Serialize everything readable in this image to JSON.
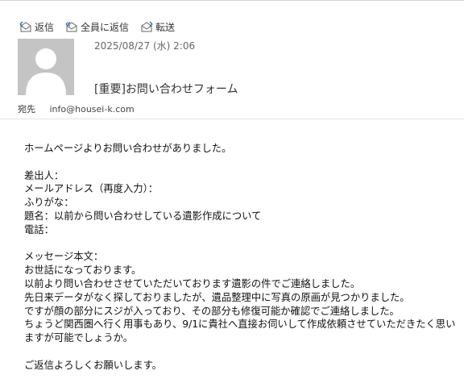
{
  "toolbar": {
    "reply": "返信",
    "reply_all": "全員に返信",
    "forward": "転送"
  },
  "header": {
    "date": "2025/08/27 (水) 2:06",
    "subject": "[重要]お問い合わせフォーム",
    "to_label": "宛先",
    "to_address": "info@housei-k.com"
  },
  "body": {
    "intro": "ホームページよりお問い合わせがありました。",
    "fields": [
      "差出人：",
      "メールアドレス（再度入力）：",
      "ふりがな：",
      "題名：以前から問い合わせしている遺影作成について",
      "電話："
    ],
    "message_label": "メッセージ本文：",
    "message_lines": [
      "お世話になっております。",
      "以前より問い合わせさせていただいております遺影の件でご連絡しました。",
      "先日来データがなく探しておりましたが、遺品整理中に写真の原画が見つかりました。",
      "ですが顔の部分にスジが入っており、その部分も修復可能か確認でご連絡しました。",
      "ちょうど関西圏へ行く用事もあり、9/1に貴社へ直接お伺いして作成依頼させていただきたく思いますが可能でしょうか。"
    ],
    "closing": "ご返信よろしくお願いします。"
  }
}
